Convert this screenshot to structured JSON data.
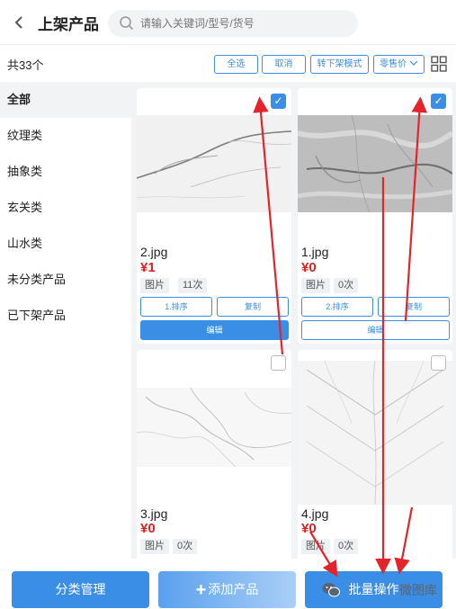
{
  "header": {
    "back_icon": "chevron-left-icon",
    "title": "上架产品",
    "search_placeholder": "请输入关键词/型号/货号",
    "search_icon": "search-icon"
  },
  "toolbar": {
    "count_text": "共33个",
    "select_all": "全选",
    "cancel": "取消",
    "mode": "转下架模式",
    "price": "零售价",
    "price_icon": "chevron-down-icon",
    "grid_icon": "grid-view-icon"
  },
  "sidebar": {
    "items": [
      {
        "label": "全部",
        "active": true
      },
      {
        "label": "纹理类"
      },
      {
        "label": "抽象类"
      },
      {
        "label": "玄关类"
      },
      {
        "label": "山水类"
      },
      {
        "label": "未分类产品"
      },
      {
        "label": "已下架产品"
      }
    ]
  },
  "products": [
    {
      "filename": "2.jpg",
      "price": "¥1",
      "type": "图片",
      "views": "11次",
      "sort_label": "1.排序",
      "copy_label": "复制",
      "edit_label": "编辑",
      "checked": true
    },
    {
      "filename": "1.jpg",
      "price": "¥0",
      "type": "图片",
      "views": "0次",
      "sort_label": "2.排序",
      "copy_label": "复制",
      "edit_label": "编辑",
      "checked": true
    },
    {
      "filename": "3.jpg",
      "price": "¥0",
      "type": "图片",
      "views": "0次",
      "checked": false
    },
    {
      "filename": "4.jpg",
      "price": "¥0",
      "type": "图片",
      "views": "0次",
      "checked": false
    }
  ],
  "bottom": {
    "category_manage": "分类管理",
    "add_product": "添加产品",
    "batch_ops": "批量操作"
  },
  "watermark": {
    "icon": "wechat-icon",
    "text": "微图库"
  },
  "colors": {
    "accent": "#3a8ee6",
    "price": "#e02020",
    "annotation_arrow": "#e3242b"
  }
}
